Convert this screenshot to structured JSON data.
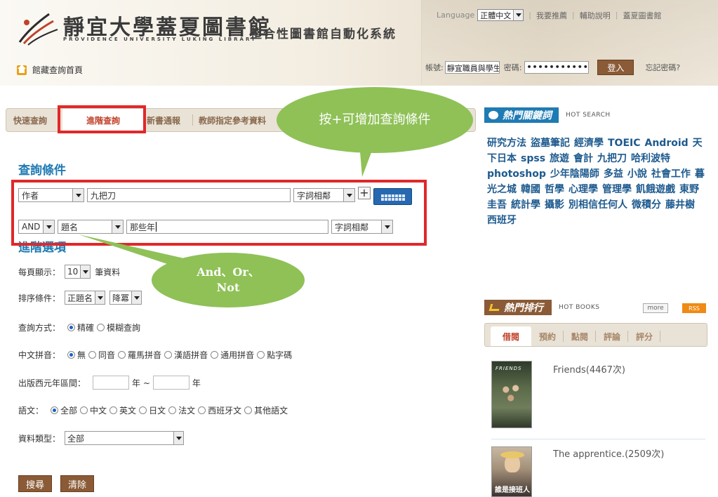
{
  "header": {
    "library_name": "靜宜大學蓋夏圖書館",
    "library_name_en": "PROVIDENCE UNIVERSITY LUKING LIBRARY",
    "system_name": "整合性圖書館自動化系統",
    "language_label": "Language",
    "language_value": "正體中文",
    "links": [
      "我要推薦",
      "輔助說明",
      "蓋夏圖書館"
    ],
    "home_label": "館藏查詢首頁",
    "account_label": "帳號:",
    "account_value": "靜宜職員與學生請",
    "password_label": "密碼:",
    "password_value": "•••••••••••••",
    "login_button": "登入",
    "forgot_link": "忘記密碼?"
  },
  "tabs": [
    "快速查詢",
    "進階查詢",
    "新書通報",
    "教師指定參考資料"
  ],
  "search": {
    "section_title": "查詢條件",
    "row1": {
      "field": "作者",
      "value": "九把刀",
      "match": "字詞相鄰"
    },
    "row2": {
      "operator": "AND",
      "field": "題名",
      "value": "那些年",
      "match": "字詞相鄰"
    },
    "plus_label": "+"
  },
  "advanced": {
    "section_title": "進階選項",
    "per_page_label": "每頁顯示：",
    "per_page_value": "10",
    "per_page_unit": "筆資料",
    "sort_label": "排序條件：",
    "sort_field": "正題名",
    "sort_order": "降冪",
    "mode_label": "查詢方式：",
    "mode_options": [
      "精確",
      "模糊查詢"
    ],
    "pinyin_label": "中文拼音：",
    "pinyin_options": [
      "無",
      "同音",
      "羅馬拼音",
      "漢語拼音",
      "通用拼音",
      "點字碼"
    ],
    "year_label": "出版西元年區間：",
    "year_from_unit": "年 ~",
    "year_to_unit": "年",
    "lang_label": "語文：",
    "lang_options": [
      "全部",
      "中文",
      "英文",
      "日文",
      "法文",
      "西班牙文",
      "其他語文"
    ],
    "type_label": "資料類型：",
    "type_value": "全部",
    "search_button": "搜尋",
    "clear_button": "清除"
  },
  "callouts": {
    "plus_hint": "按+可增加查詢條件",
    "operator_hint_line1": "And、Or、",
    "operator_hint_line2": "Not"
  },
  "hot_search": {
    "title": "熱門關鍵詞",
    "subtitle": "HOT SEARCH",
    "keywords": [
      "研究方法",
      "盜墓筆記",
      "經濟學",
      "TOEIC",
      "Android",
      "天下日本",
      "spss",
      "旅遊",
      "會計",
      "九把刀",
      "哈利波特",
      "photoshop",
      "少年陰陽師",
      "多益",
      "小說",
      "社會工作",
      "暮光之城",
      "韓國",
      "哲學",
      "心理學",
      "管理學",
      "飢餓遊戲",
      "東野圭吾",
      "統計學",
      "攝影",
      "別相信任何人",
      "微積分",
      "藤井樹",
      "西班牙"
    ]
  },
  "hot_books": {
    "title": "熱門排行",
    "subtitle": "HOT BOOKS",
    "more": "more",
    "rss": "RSS",
    "tabs": [
      "借閱",
      "預約",
      "點閱",
      "評論",
      "評分"
    ],
    "items": [
      {
        "title": "Friends(4467次)",
        "cover_text": "FRIENDS"
      },
      {
        "title": "The apprentice.(2509次)",
        "cover_text": "誰是接班人"
      }
    ]
  },
  "colors": {
    "accent_blue": "#1f7bb3",
    "brown": "#8a5b36",
    "highlight_red": "#e0282a",
    "callout_green": "#8fc157"
  }
}
